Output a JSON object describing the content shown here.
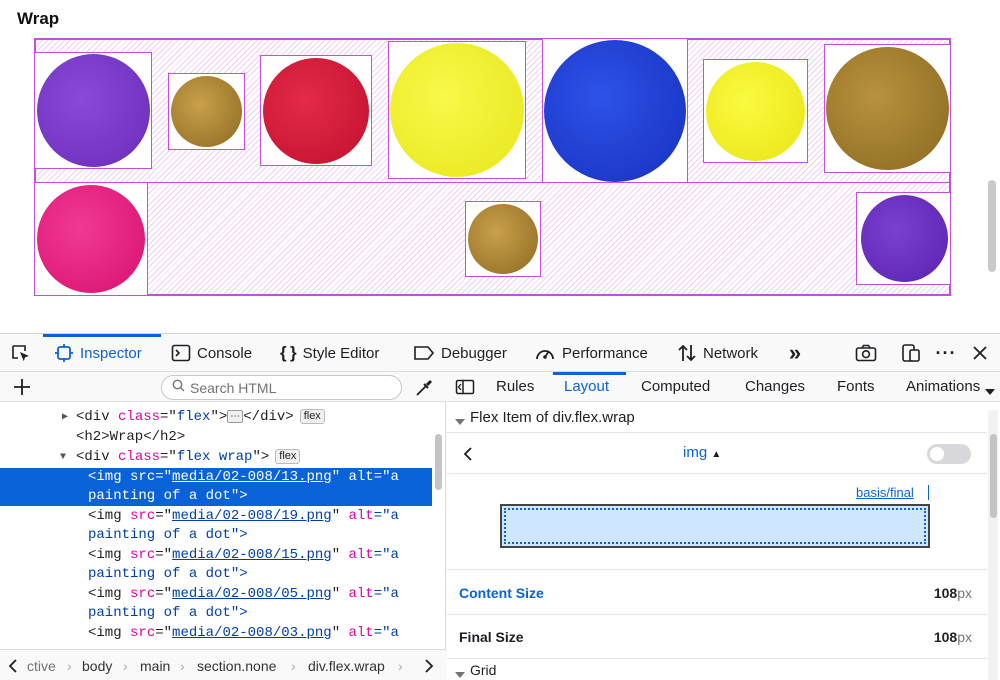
{
  "webpage": {
    "heading": "Wrap",
    "dots": [
      {
        "color": "#7a38c8"
      },
      {
        "color": "#b08a2e"
      },
      {
        "color": "#d8183a"
      },
      {
        "color": "#f1f12c"
      },
      {
        "color": "#1f3fd6"
      },
      {
        "color": "#f3ef2a"
      },
      {
        "color": "#a8802c"
      },
      {
        "color": "#ea1f86"
      },
      {
        "color": "#b08a2e"
      },
      {
        "color": "#6a2ec4"
      }
    ]
  },
  "devtools": {
    "tabs": [
      {
        "label": "Inspector",
        "icon": "inspector-icon"
      },
      {
        "label": "Console",
        "icon": "console-icon"
      },
      {
        "label": "Style Editor",
        "icon": "style-editor-icon"
      },
      {
        "label": "Debugger",
        "icon": "debugger-icon"
      },
      {
        "label": "Performance",
        "icon": "performance-icon"
      },
      {
        "label": "Network",
        "icon": "network-icon"
      }
    ],
    "search_placeholder": "Search HTML",
    "tree": {
      "line0": {
        "tag_open": "<div",
        "attr": "class",
        "eq": "=\"",
        "val": "flex",
        "rest": "\">",
        "close": "</div>",
        "badge": "flex",
        "ellipsis": "⋯"
      },
      "line1": {
        "text": "<h2>Wrap</h2>"
      },
      "line2": {
        "tag_open": "<div",
        "attr": "class",
        "eq": "=\"",
        "val": "flex wrap",
        "rest": "\">",
        "badge": "flex"
      },
      "imgs": [
        {
          "src": "media/02-008/13.png"
        },
        {
          "src": "media/02-008/19.png"
        },
        {
          "src": "media/02-008/15.png"
        },
        {
          "src": "media/02-008/05.png"
        },
        {
          "src": "media/02-008/03.png"
        }
      ],
      "img_open": "<img",
      "src_attr": "src",
      "alt_attr": "alt",
      "alt_first": "=\"a",
      "alt_rest": "painting of a dot\">"
    },
    "breadcrumbs": [
      "ctive",
      "body",
      "main",
      "section.none",
      "div.flex.wrap"
    ],
    "sidebar_tabs": [
      "Rules",
      "Layout",
      "Computed",
      "Changes",
      "Fonts",
      "Animations"
    ],
    "flex_item_header": "Flex Item of div.flex.wrap",
    "item_selector": "img",
    "basis_label": "basis/final",
    "content_size": {
      "label": "Content Size",
      "value": "108",
      "unit": "px"
    },
    "final_size": {
      "label": "Final Size",
      "value": "108",
      "unit": "px"
    },
    "grid_section": "Grid"
  }
}
